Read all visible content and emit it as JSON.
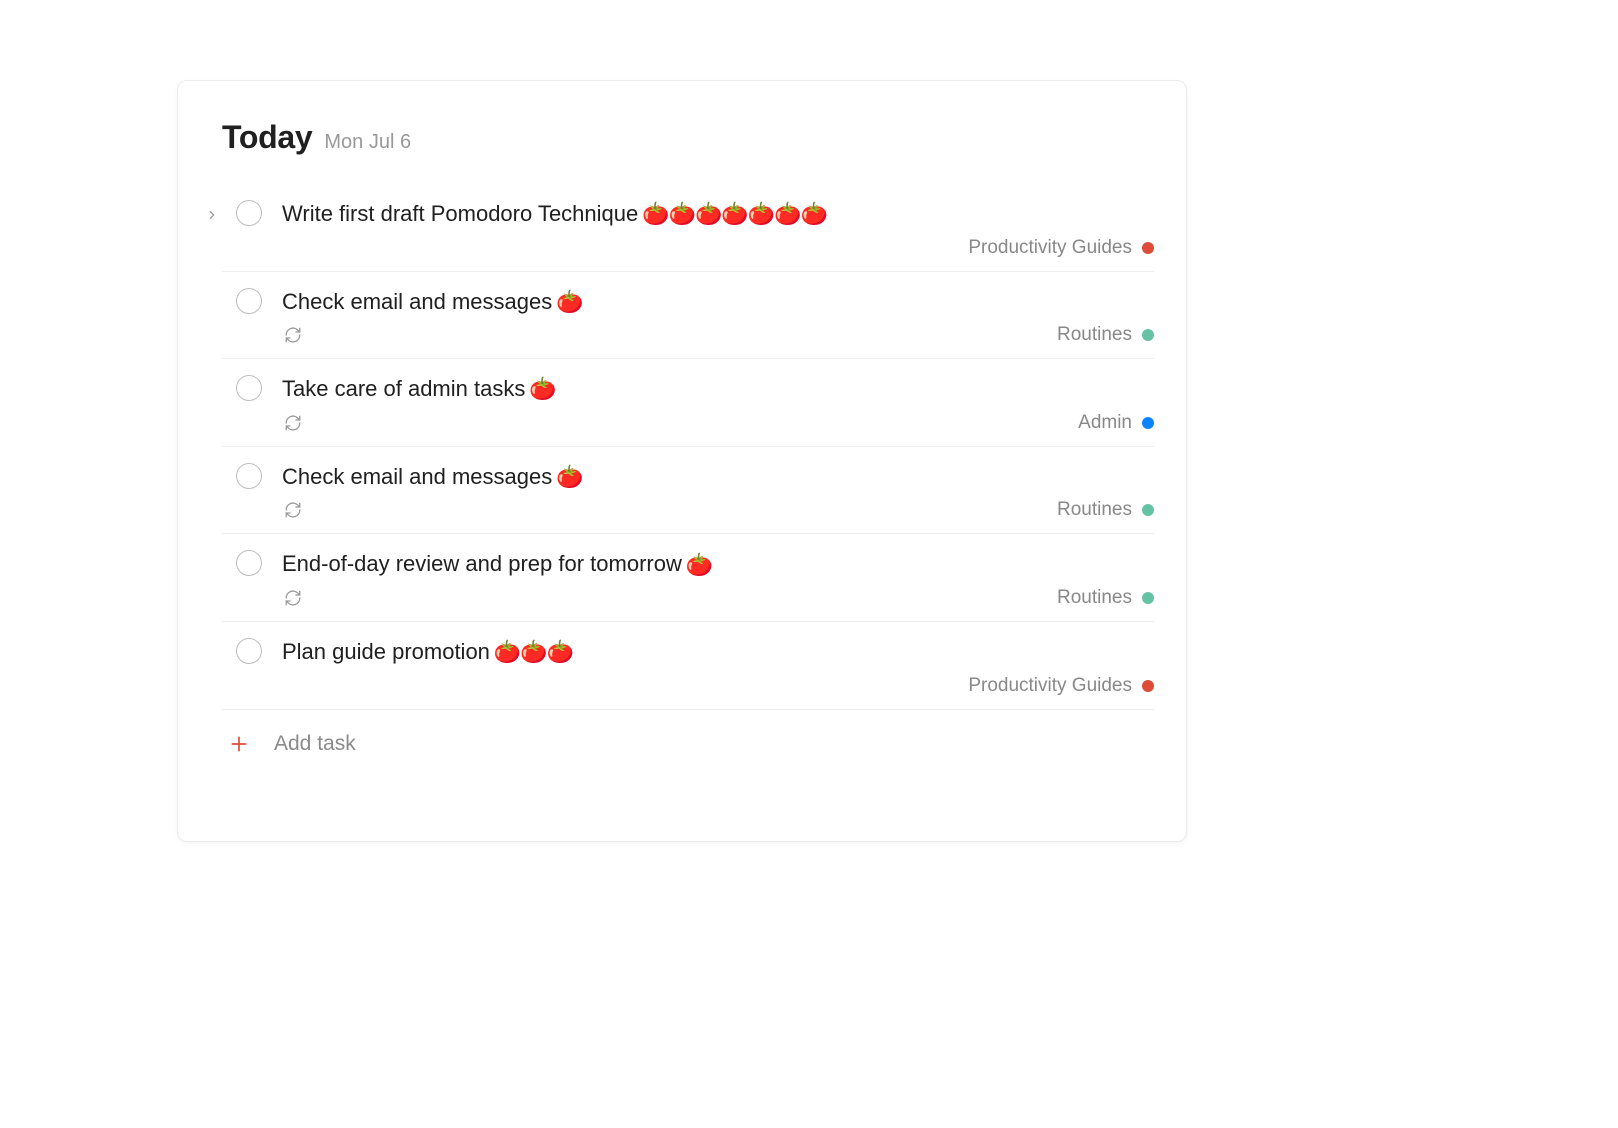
{
  "header": {
    "title": "Today",
    "date": "Mon Jul 6"
  },
  "projects": {
    "productivity": {
      "label": "Productivity Guides",
      "color": "#dd4b39"
    },
    "routines": {
      "label": "Routines",
      "color": "#66c2a5"
    },
    "admin": {
      "label": "Admin",
      "color": "#0d84ff"
    }
  },
  "tasks": [
    {
      "title": "Write first draft Pomodoro Technique",
      "pomodoros": 7,
      "recurring": false,
      "expandable": true,
      "project": "productivity"
    },
    {
      "title": "Check email and messages",
      "pomodoros": 1,
      "recurring": true,
      "expandable": false,
      "project": "routines"
    },
    {
      "title": "Take care of admin tasks",
      "pomodoros": 1,
      "recurring": true,
      "expandable": false,
      "project": "admin"
    },
    {
      "title": "Check email and messages",
      "pomodoros": 1,
      "recurring": true,
      "expandable": false,
      "project": "routines"
    },
    {
      "title": "End-of-day review and prep for tomorrow",
      "pomodoros": 1,
      "recurring": true,
      "expandable": false,
      "project": "routines"
    },
    {
      "title": "Plan guide promotion",
      "pomodoros": 3,
      "recurring": false,
      "expandable": false,
      "project": "productivity"
    }
  ],
  "add_task_label": "Add task",
  "tomato_emoji": "🍅"
}
